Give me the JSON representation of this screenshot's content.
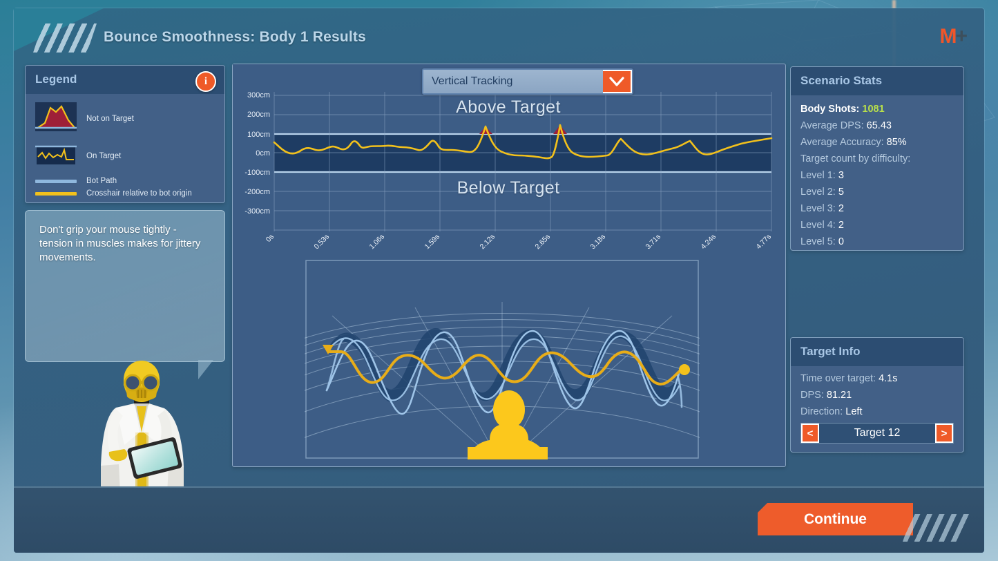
{
  "window": {
    "title": "Bounce Smoothness: Body 1 Results",
    "logo_m": "M",
    "logo_plus": "+"
  },
  "legend": {
    "title": "Legend",
    "info_icon": "i",
    "items": [
      {
        "label": "Not on Target",
        "swatch": "peak-red-fill"
      },
      {
        "label": "On Target",
        "swatch": "box-yellow-trace"
      },
      {
        "label": "Bot Path",
        "swatch": "line-lightblue",
        "color": "#8fb8de"
      },
      {
        "label": "Crosshair relative to bot origin",
        "swatch": "line-yellow",
        "color": "#f2c11c"
      }
    ]
  },
  "tip": {
    "text": "Don't grip your mouse tightly - tension in muscles makes for jittery movements."
  },
  "graph": {
    "dropdown_value": "Vertical Tracking",
    "dropdown_icon": "chevron-down-icon",
    "above_label": "Above Target",
    "below_label": "Below Target"
  },
  "chart_data": {
    "type": "line",
    "title": "Vertical Tracking",
    "xlabel": "",
    "ylabel": "cm",
    "ylim": [
      -300,
      300
    ],
    "yticks": [
      300,
      200,
      100,
      0,
      -100,
      -200,
      -300
    ],
    "ytick_labels": [
      "300cm",
      "200cm",
      "100cm",
      "0cm",
      "-100cm",
      "-200cm",
      "-300cm"
    ],
    "x": [
      0,
      0.53,
      1.06,
      1.59,
      2.12,
      2.65,
      3.18,
      3.71,
      4.24,
      4.77
    ],
    "xtick_labels": [
      "0s",
      "0.53s",
      "1.06s",
      "1.59s",
      "2.12s",
      "2.65s",
      "3.18s",
      "3.71s",
      "4.24s",
      "4.77s"
    ],
    "grid": true,
    "on_target_band": [
      -70,
      70
    ],
    "annotations": [
      "Above Target",
      "Below Target"
    ],
    "series": [
      {
        "name": "Crosshair relative to bot origin",
        "color": "#f2c11c",
        "values": [
          48,
          30,
          10,
          2,
          6,
          14,
          20,
          24,
          22,
          26,
          30,
          34,
          46,
          28,
          18,
          22,
          60,
          38,
          40,
          42,
          38,
          36,
          34,
          30,
          36,
          30,
          24,
          40,
          68,
          34,
          28,
          26,
          24,
          22,
          26,
          96,
          52,
          30,
          22,
          20,
          16,
          14,
          12,
          16,
          10,
          2,
          -4,
          -10,
          -4,
          14,
          92,
          46,
          26,
          18,
          14,
          10,
          8,
          12,
          10,
          14,
          62,
          34,
          24,
          26,
          28,
          30,
          34,
          40,
          46,
          64,
          20,
          26,
          32,
          38,
          44,
          50,
          56,
          62
        ]
      }
    ],
    "out_of_band_peaks": [
      {
        "t": 2.32,
        "value": 96
      },
      {
        "t": 3.32,
        "value": 92
      }
    ]
  },
  "scene": {
    "bot_path_color": "#9ec4e8",
    "crosshair_color": "#e8ad18",
    "start_marker": "triangle-marker",
    "end_marker": "dot-marker",
    "silhouette": "player-silhouette"
  },
  "scenario_stats": {
    "title": "Scenario Stats",
    "rows": [
      {
        "label": "Body Shots:",
        "value": "1081",
        "value_style": "green",
        "bright": true
      },
      {
        "label": "Average DPS:",
        "value": "65.43",
        "value_style": "white"
      },
      {
        "label": "Average Accuracy:",
        "value": "85%",
        "value_style": "white"
      },
      {
        "label": "Target count by difficulty:",
        "value": "",
        "value_style": "white"
      },
      {
        "label": "Level 1:",
        "value": "3",
        "value_style": "white"
      },
      {
        "label": "Level 2:",
        "value": "5",
        "value_style": "white"
      },
      {
        "label": "Level 3:",
        "value": "2",
        "value_style": "white"
      },
      {
        "label": "Level 4:",
        "value": "2",
        "value_style": "white"
      },
      {
        "label": "Level 5:",
        "value": "0",
        "value_style": "white"
      }
    ]
  },
  "target_info": {
    "title": "Target Info",
    "rows": [
      {
        "label": "Time over target:",
        "value": "4.1s"
      },
      {
        "label": "DPS:",
        "value": "81.21"
      },
      {
        "label": "Direction:",
        "value": "Left"
      }
    ],
    "prev_icon": "<",
    "next_icon": ">",
    "current_target": "Target 12"
  },
  "footer": {
    "continue_label": "Continue"
  },
  "colors": {
    "accent_orange": "#ef5a28",
    "panel_blue": "#426087",
    "header_blue": "#2c4d72",
    "crosshair_yellow": "#f2c11c",
    "bot_path_blue": "#8fb8de",
    "not_on_target_red": "#9e1f38",
    "stat_green": "#b9e04a"
  }
}
